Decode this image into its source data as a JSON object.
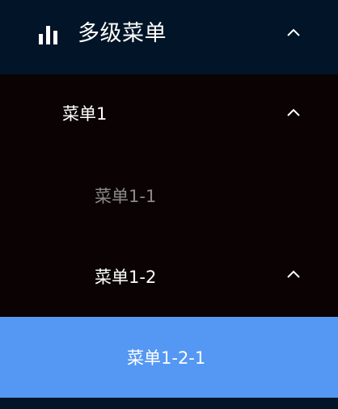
{
  "menu": {
    "title": "多级菜单",
    "title_icon": "bar-chart-icon",
    "submenu_1": {
      "label": "菜单1",
      "icon": "chevron-up-icon",
      "items": [
        {
          "label": "菜单1-1"
        }
      ],
      "submenu_1_2": {
        "label": "菜单1-2",
        "icon": "chevron-up-icon",
        "items": [
          {
            "label": "菜单1-2-1",
            "active": true
          }
        ]
      }
    }
  },
  "colors": {
    "header_bg": "#021427",
    "submenu_bg": "#0b0303",
    "active_bg": "#5598f3",
    "text": "#ffffff",
    "text_muted": "#8a8a8a"
  }
}
